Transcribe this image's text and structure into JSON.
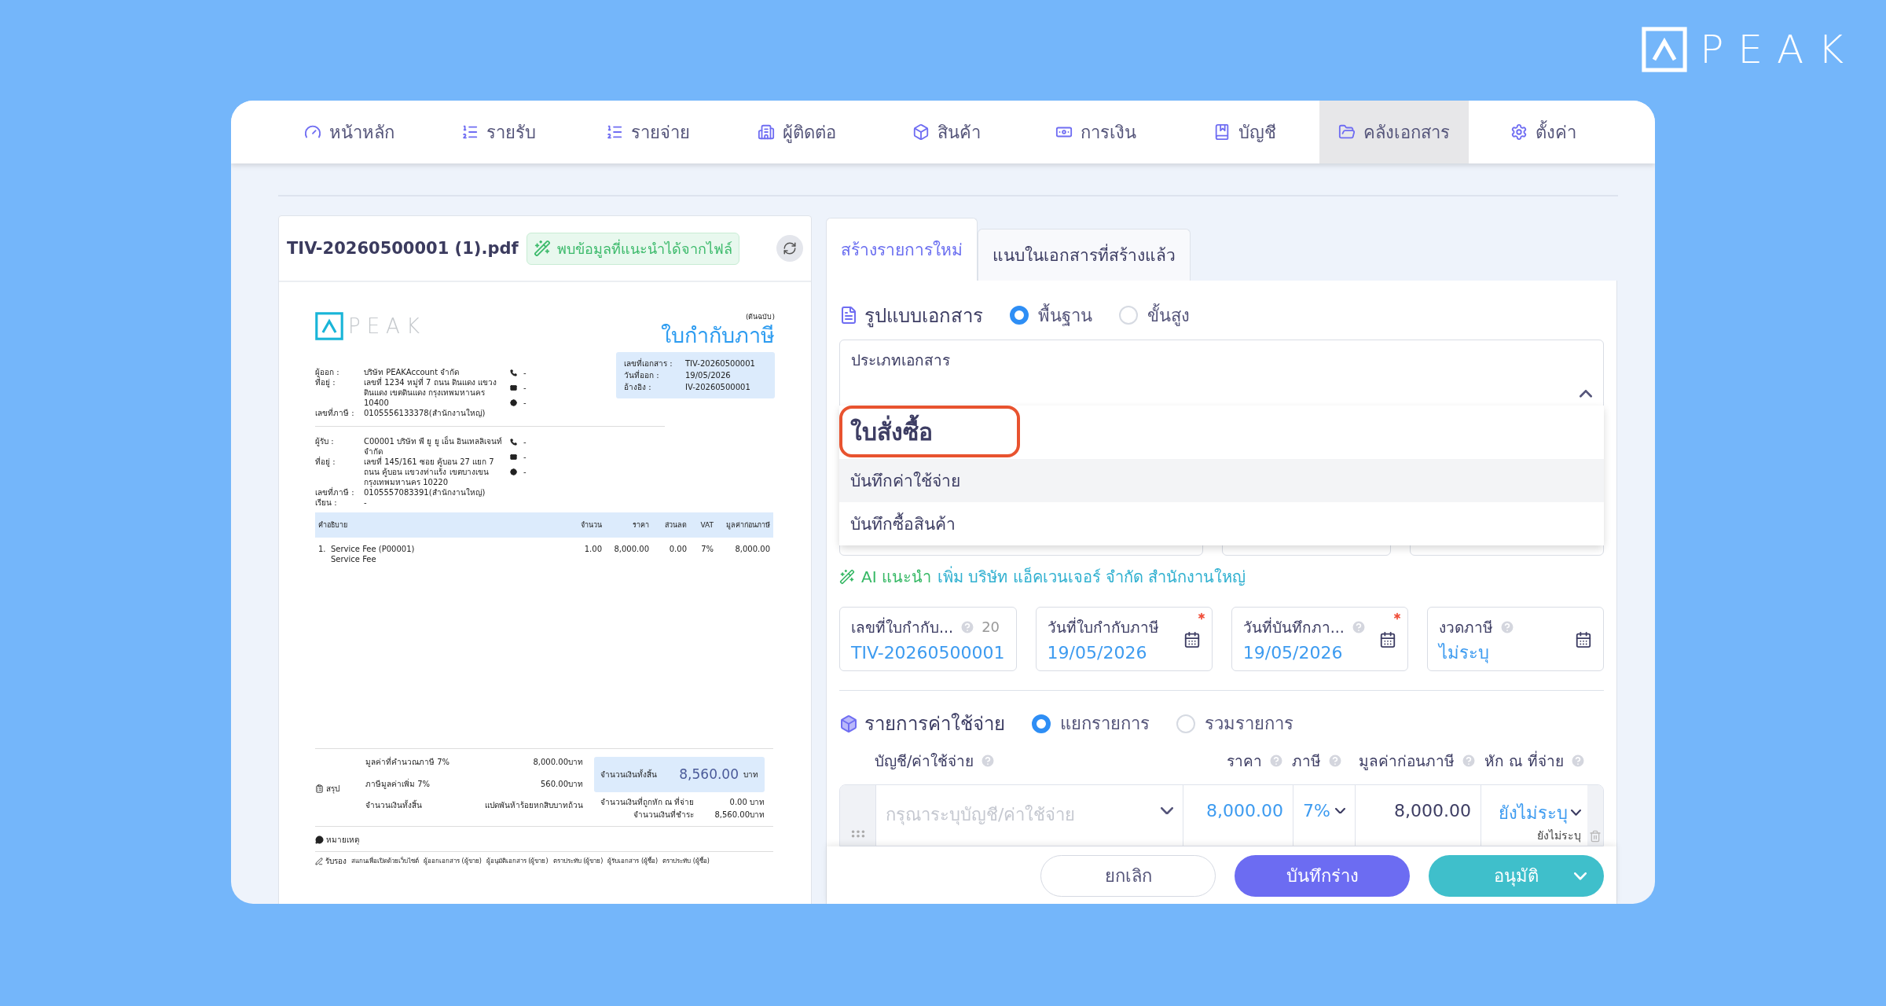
{
  "brand": {
    "name": "PEAK"
  },
  "nav": [
    {
      "label": "หน้าหลัก",
      "selected": false
    },
    {
      "label": "รายรับ",
      "selected": false
    },
    {
      "label": "รายจ่าย",
      "selected": false
    },
    {
      "label": "ผู้ติดต่อ",
      "selected": false
    },
    {
      "label": "สินค้า",
      "selected": false
    },
    {
      "label": "การเงิน",
      "selected": false
    },
    {
      "label": "บัญชี",
      "selected": false
    },
    {
      "label": "คลังเอกสาร",
      "selected": true
    },
    {
      "label": "ตั้งค่า",
      "selected": false
    }
  ],
  "preview": {
    "file_name": "TIV-20260500001 (1).pdf",
    "suggestion_badge": "พบข้อมูลที่แนะนำได้จากไฟล์",
    "document": {
      "brand": "PEAK",
      "copy_label": "(ต้นฉบับ)",
      "title": "ใบกำกับภาษี",
      "issuer": [
        {
          "label": "ผู้ออก :",
          "value": "บริษัท PEAKAccount จำกัด"
        },
        {
          "label": "ที่อยู่ :",
          "value": "เลขที่ 1234 หมู่ที่ 7 ถนน ดินแดง แขวง ดินแดง เขตดินแดง กรุงเทพมหานคร 10400"
        },
        {
          "label": "เลขที่ภาษี :",
          "value": "0105556133378(สำนักงานใหญ่)"
        }
      ],
      "issuer_contacts": [
        "-",
        "-",
        "-"
      ],
      "info": [
        {
          "label": "เลขที่เอกสาร :",
          "value": "TIV-20260500001"
        },
        {
          "label": "วันที่ออก :",
          "value": "19/05/2026"
        },
        {
          "label": "อ้างอิง :",
          "value": "IV-20260500001"
        }
      ],
      "receiver": [
        {
          "label": "ผู้รับ :",
          "value": "C00001 บริษัท พี ยู ยู เอ็น อินเทลลิเจนท์ จำกัด"
        },
        {
          "label": "ที่อยู่ :",
          "value": "เลขที่ 145/161 ซอย คู้บอน 27 แยก 7 ถนน คู้บอน แขวงท่าแร้ง เขตบางเขน กรุงเทพมหานคร 10220"
        },
        {
          "label": "เลขที่ภาษี :",
          "value": "0105557083391(สำนักงานใหญ่)"
        },
        {
          "label": "เรียน :",
          "value": "-"
        }
      ],
      "receiver_contacts": [
        "-",
        "-",
        "-"
      ],
      "table": {
        "columns": [
          "คำอธิบาย",
          "จำนวน",
          "ราคา",
          "ส่วนลด",
          "VAT",
          "มูลค่าก่อนภาษี"
        ],
        "rows": [
          {
            "index": "1.",
            "description": "Service Fee (P00001)",
            "detail": "Service Fee",
            "quantity": "1.00",
            "price": "8,000.00",
            "discount": "0.00",
            "vat": "7%",
            "amount": "8,000.00"
          }
        ]
      },
      "summary": {
        "label": "สรุป",
        "lines": [
          {
            "label": "มูลค่าที่คำนวณภาษี 7%",
            "value": "8,000.00บาท"
          },
          {
            "label": "ภาษีมูลค่าเพิ่ม 7%",
            "value": "560.00บาท"
          },
          {
            "label": "จำนวนเงินทั้งสิ้น",
            "value": "แปดพันห้าร้อยหกสิบบาทถ้วน"
          }
        ],
        "total_label": "จำนวนเงินทั้งสิ้น",
        "total_value": "8,560.00",
        "total_unit": "บาท",
        "after": [
          {
            "label": "จำนวนเงินที่ถูกหัก ณ ที่จ่าย",
            "value": "0.00 บาท"
          },
          {
            "label": "จำนวนเงินที่ชำระ",
            "value": "8,560.00บาท"
          }
        ]
      },
      "note_label": "หมายเหตุ",
      "signature_label": "รับรอง",
      "signature_fields": [
        "สแกนเพื่อเปิดด้วยเว็บไซต์",
        "ผู้ออกเอกสาร (ผู้ขาย)",
        "ผู้อนุมัติเอกสาร (ผู้ขาย)",
        "ตราประทับ (ผู้ขาย)",
        "ผู้รับเอกสาร (ผู้ซื้อ)",
        "ตราประทับ (ผู้ซื้อ)"
      ]
    }
  },
  "form": {
    "tabs": [
      {
        "label": "สร้างรายการใหม่",
        "selected": true
      },
      {
        "label": "แนบในเอกสารที่สร้างแล้ว",
        "selected": false
      }
    ],
    "doc_format": {
      "title": "รูปแบบเอกสาร",
      "options": [
        {
          "label": "พื้นฐาน",
          "selected": true
        },
        {
          "label": "ขั้นสูง",
          "selected": false
        }
      ]
    },
    "doc_type": {
      "label": "ประเภทเอกสาร",
      "expanded": true,
      "options": [
        {
          "label": "ใบสั่งซื้อ",
          "annotated": true,
          "hovered": false
        },
        {
          "label": "บันทึกค่าใช้จ่าย",
          "annotated": false,
          "hovered": true
        },
        {
          "label": "บันทึกซื้อสินค้า",
          "annotated": false,
          "hovered": false
        }
      ]
    },
    "ai_hint": {
      "label": "AI แนะนำ",
      "link": "เพิ่ม บริษัท แอ็คเวนเจอร์ จำกัด สำนักงานใหญ่"
    },
    "fields": [
      {
        "label": "เลขที่ใบกำกับ...",
        "help": true,
        "counter": "20",
        "required": false,
        "calendar": false,
        "value": "TIV-20260500001"
      },
      {
        "label": "วันที่ใบกำกับภาษี",
        "help": false,
        "required": true,
        "calendar": true,
        "value": "19/05/2026"
      },
      {
        "label": "วันที่บันทึกภา...",
        "help": true,
        "required": true,
        "calendar": true,
        "value": "19/05/2026"
      },
      {
        "label": "งวดภาษี",
        "help": true,
        "required": false,
        "calendar": true,
        "value": "ไม่ระบุ"
      }
    ],
    "items": {
      "title": "รายการค่าใช้จ่าย",
      "modes": [
        {
          "label": "แยกรายการ",
          "selected": true
        },
        {
          "label": "รวมรายการ",
          "selected": false
        }
      ],
      "columns": [
        "บัญชี/ค่าใช้จ่าย",
        "ราคา",
        "ภาษี",
        "มูลค่าก่อนภาษี",
        "หัก ณ ที่จ่าย"
      ],
      "row": {
        "account_placeholder": "กรุณาระบุบัญชี/ค่าใช้จ่าย",
        "price": "8,000.00",
        "tax": "7%",
        "amount": "8,000.00",
        "withholding": "ยังไม่ระบุ",
        "withholding_note": "ยังไม่ระบุ"
      }
    },
    "actions": [
      {
        "label": "ยกเลิก",
        "kind": "outline"
      },
      {
        "label": "บันทึกร่าง",
        "kind": "draft"
      },
      {
        "label": "อนุมัติ",
        "kind": "approve"
      }
    ]
  }
}
